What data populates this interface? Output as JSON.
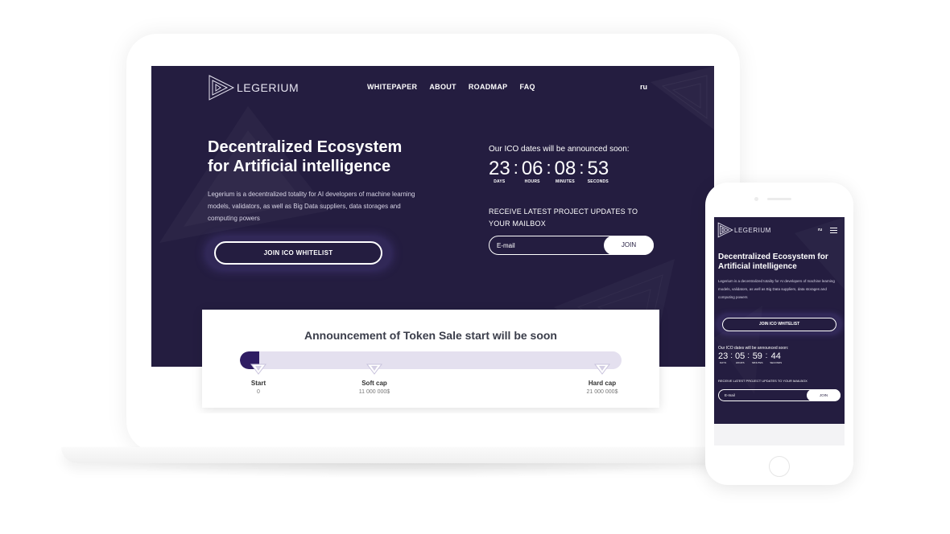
{
  "brand": {
    "name": "LEGERIUM"
  },
  "nav": {
    "items": [
      {
        "label": "WHITEPAPER"
      },
      {
        "label": "ABOUT"
      },
      {
        "label": "ROADMAP"
      },
      {
        "label": "FAQ"
      }
    ],
    "lang": "ru"
  },
  "hero": {
    "title_line1": "Decentralized Ecosystem",
    "title_line2": "for Artificial intelligence",
    "description": "Legerium is a decentralized totality for AI developers of machine learning models, validators, as well as Big Data suppliers, data storages and computing powers",
    "cta_label": "JOIN ICO WHITELIST"
  },
  "ico": {
    "label": "Our ICO dates will be announced soon:",
    "countdown": [
      {
        "value": "23",
        "unit": "DAYS"
      },
      {
        "value": "06",
        "unit": "HOURS"
      },
      {
        "value": "08",
        "unit": "MINUTES"
      },
      {
        "value": "53",
        "unit": "SECONDS"
      }
    ],
    "separator": ":"
  },
  "subscribe": {
    "label": "RECEIVE LATEST PROJECT UPDATES TO YOUR MAILBOX",
    "placeholder": "E-mail",
    "button_label": "JOIN"
  },
  "token_sale": {
    "title": "Announcement of Token Sale start will be soon",
    "progress_fraction": 0.05,
    "milestones": [
      {
        "label": "Start",
        "value": "0"
      },
      {
        "label": "Soft cap",
        "value": "11 000 000$"
      },
      {
        "label": "Hard cap",
        "value": "21 000 000$"
      }
    ]
  },
  "mobile": {
    "brand": "LEGERIUM",
    "lang": "ru",
    "title": "Decentralized Ecosystem for Artificial intelligence",
    "description": "Legerium is a decentralized totality for AI developers of machine learning models, validators, as well as Big Data suppliers, data storages and computing powers",
    "cta_label": "JOIN ICO WHITELIST",
    "ico_label": "Our ICO dates will be announced soon:",
    "countdown": [
      {
        "value": "23",
        "unit": "DAYS"
      },
      {
        "value": "05",
        "unit": "HOURS"
      },
      {
        "value": "59",
        "unit": "MINUTES"
      },
      {
        "value": "44",
        "unit": "SECONDS"
      }
    ],
    "updates_label": "RECEIVE LATEST PROJECT UPDATES TO YOUR MAILBOX",
    "placeholder": "E-mail",
    "join_label": "JOIN",
    "menu_icon": "hamburger-icon"
  },
  "colors": {
    "hero_bg": "#241d40",
    "progress_fill": "#2f1d63",
    "progress_track": "#e4e0ef",
    "text_light": "#ffffff"
  }
}
